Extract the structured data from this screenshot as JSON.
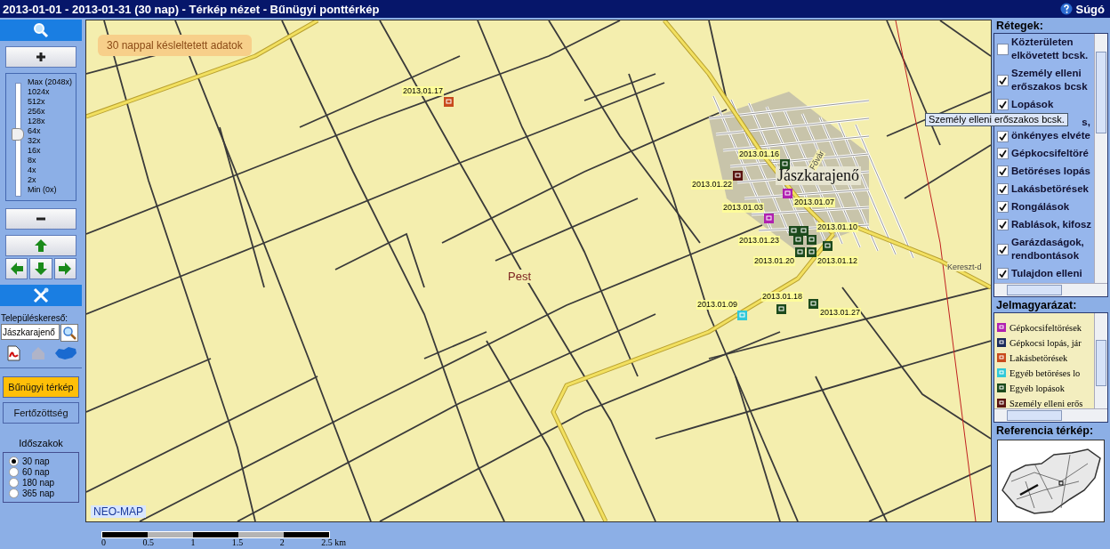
{
  "window": {
    "title": "2013-01-01 - 2013-01-31 (30 nap) - Térkép nézet - Bűnügyi ponttérkép",
    "help": "Súgó"
  },
  "sidebar": {
    "zoom_labels": [
      "Max (2048x)",
      "1024x",
      "512x",
      "256x",
      "128x",
      "64x",
      "32x",
      "16x",
      "8x",
      "4x",
      "2x",
      "Min (0x)"
    ],
    "zoom": {
      "level": 0.55
    },
    "search_label": "Településkereső:",
    "search_value": "Jászkarajenő",
    "modes": [
      {
        "label": "Bűnügyi térkép",
        "selected": true
      },
      {
        "label": "Fertőzöttség",
        "selected": false
      }
    ],
    "periods_title": "Időszakok",
    "periods": [
      {
        "label": "30 nap",
        "selected": true
      },
      {
        "label": "60 nap",
        "selected": false
      },
      {
        "label": "180 nap",
        "selected": false
      },
      {
        "label": "365 nap",
        "selected": false
      }
    ]
  },
  "map": {
    "notice": "30 nappal késleltetett adatok",
    "town": "Jászkarajenő",
    "county": "Pest",
    "street_labels": [
      "Fővár",
      "Kereszt-d"
    ],
    "brand": "NEO-MAP",
    "date_labels": [
      "2013.01.17",
      "2013.01.16",
      "2013.01.22",
      "2013.01.07",
      "2013.01.03",
      "2013.01.10",
      "2013.01.23",
      "2013.01.20",
      "2013.01.12",
      "2013.01.18",
      "2013.01.09",
      "2013.01.27"
    ],
    "markers": [
      {
        "color": "#c84a1c"
      },
      {
        "color": "#1c4a1c"
      },
      {
        "color": "#5a1410"
      },
      {
        "color": "#b020b0"
      },
      {
        "color": "#b020b0"
      },
      {
        "color": "#1c4a1c"
      },
      {
        "color": "#1c4a1c"
      },
      {
        "color": "#1c4a1c"
      },
      {
        "color": "#1c4a1c"
      },
      {
        "color": "#1c4a1c"
      },
      {
        "color": "#1c4a1c"
      },
      {
        "color": "#1c4a1c"
      },
      {
        "color": "#1c4a1c"
      },
      {
        "color": "#1c4a1c"
      },
      {
        "color": "#30c8d8"
      }
    ]
  },
  "scale_labels": [
    "0",
    "0.5",
    "1",
    "1.5",
    "2",
    "2.5 km"
  ],
  "layers_title": "Rétegek:",
  "layers": [
    {
      "lines": [
        "Közterületen",
        "elkövetett bcsk."
      ],
      "checked": false
    },
    {
      "lines": [
        "Személy elleni",
        "erőszakos bcsk"
      ],
      "checked": true
    },
    {
      "lines": [
        "Lopások"
      ],
      "checked": true
    },
    {
      "lines": [
        "s,",
        "önkényes elvéte"
      ],
      "checked": true
    },
    {
      "lines": [
        "Gépkocsifeltöré"
      ],
      "checked": true
    },
    {
      "lines": [
        "Betöréses lopás"
      ],
      "checked": true
    },
    {
      "lines": [
        "Lakásbetörések"
      ],
      "checked": true
    },
    {
      "lines": [
        "Rongálások"
      ],
      "checked": true
    },
    {
      "lines": [
        "Rablások, kifosz"
      ],
      "checked": true
    },
    {
      "lines": [
        "Garázdaságok,",
        "rendbontások"
      ],
      "checked": true
    },
    {
      "lines": [
        "Tulajdon elleni"
      ],
      "checked": true
    }
  ],
  "tooltip": "Személy elleni erőszakos bcsk.",
  "legend_title": "Jelmagyarázat:",
  "legend": [
    {
      "label": "Gépkocsifeltörések",
      "color": "#b020b0"
    },
    {
      "label": "Gépkocsi lopás, jár",
      "color": "#1a2a5a"
    },
    {
      "label": "Lakásbetörések",
      "color": "#c84a1c"
    },
    {
      "label": "Egyéb betöréses lo",
      "color": "#30c8d8"
    },
    {
      "label": "Egyéb lopások",
      "color": "#1c4a1c"
    },
    {
      "label": "Személy elleni erős",
      "color": "#5a1410"
    }
  ],
  "reference_title": "Referencia térkép:"
}
